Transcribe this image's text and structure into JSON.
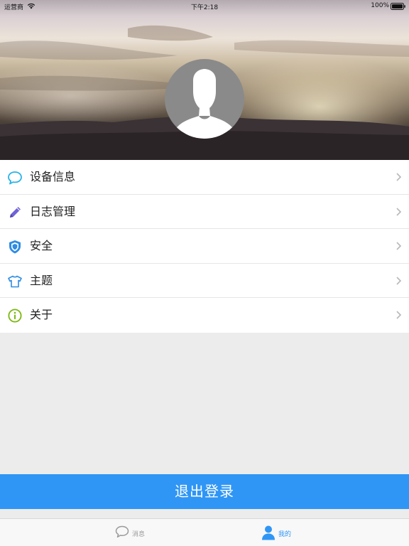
{
  "status_bar": {
    "carrier": "运营商",
    "time": "下午2:18",
    "battery_percent": "100%"
  },
  "profile": {
    "avatar_icon": "default-user-avatar-icon"
  },
  "menu": {
    "items": [
      {
        "label": "设备信息",
        "icon": "chat-bubble-icon",
        "color": "#29b3e6"
      },
      {
        "label": "日志管理",
        "icon": "pencil-icon",
        "color": "#6f63d6"
      },
      {
        "label": "安全",
        "icon": "shield-icon",
        "color": "#2f8de4"
      },
      {
        "label": "主题",
        "icon": "tshirt-icon",
        "color": "#2f8de4"
      },
      {
        "label": "关于",
        "icon": "info-icon",
        "color": "#7ab80e"
      }
    ]
  },
  "logout_button": {
    "label": "退出登录",
    "color": "#2f96f6"
  },
  "tab_bar": {
    "tabs": [
      {
        "label": "消息",
        "icon": "chat-bubble-icon",
        "active": false
      },
      {
        "label": "我的",
        "icon": "user-icon",
        "active": true
      }
    ],
    "active_color": "#2f96f6",
    "inactive_color": "#9a9a9a"
  }
}
